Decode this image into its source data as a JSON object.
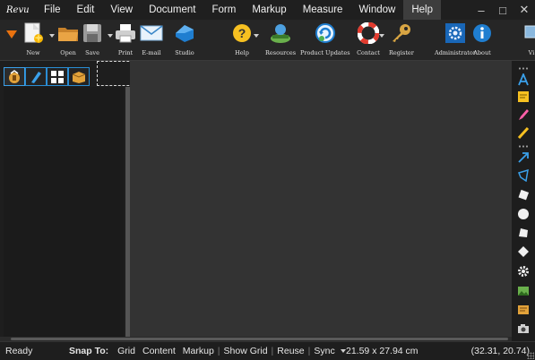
{
  "app": {
    "logo_text": "Revu"
  },
  "menu": {
    "items": [
      {
        "label": "File"
      },
      {
        "label": "Edit"
      },
      {
        "label": "View"
      },
      {
        "label": "Document"
      },
      {
        "label": "Form"
      },
      {
        "label": "Markup"
      },
      {
        "label": "Measure"
      },
      {
        "label": "Window"
      },
      {
        "label": "Help"
      }
    ]
  },
  "window_controls": {
    "minimize": "–",
    "maximize": "□",
    "close": "✕"
  },
  "toolbar": {
    "buttons": [
      {
        "label": "New",
        "icon": "new-document-icon"
      },
      {
        "label": "Open",
        "icon": "folder-icon"
      },
      {
        "label": "Save",
        "icon": "floppy-disk-icon"
      },
      {
        "label": "Print",
        "icon": "printer-icon"
      },
      {
        "label": "E-mail",
        "icon": "envelope-icon"
      },
      {
        "label": "Studio",
        "icon": "studio-icon"
      },
      {
        "label": "Help",
        "icon": "question-icon"
      },
      {
        "label": "Resources",
        "icon": "resources-icon"
      },
      {
        "label": "Product Updates",
        "icon": "update-icon"
      },
      {
        "label": "Contact",
        "icon": "lifebuoy-icon"
      },
      {
        "label": "Register",
        "icon": "key-icon"
      },
      {
        "label": "Administrator",
        "icon": "admin-gear-icon"
      },
      {
        "label": "About",
        "icon": "info-icon"
      },
      {
        "label": "Vi",
        "icon": "monitor-icon"
      }
    ]
  },
  "left_panel": {
    "tabs": [
      "bookmarks-tab-icon",
      "markup-tab-icon",
      "thumbnails-tab-icon",
      "properties-tab-icon"
    ]
  },
  "right_strip": {
    "tools": [
      "text-tool-icon",
      "note-tool-icon",
      "highlighter-tool-icon",
      "pen-tool-icon",
      "arrow-tool-icon",
      "polygon-tool-icon",
      "rectangle-tool-icon",
      "ellipse-tool-icon",
      "cloud-tool-icon",
      "stamp-tool-icon",
      "gear-tool-icon",
      "image-tool-icon",
      "sketch-tool-icon",
      "camera-tool-icon"
    ]
  },
  "statusbar": {
    "ready": "Ready",
    "snap_to": "Snap To:",
    "snap_options": [
      "Grid",
      "Content",
      "Markup",
      "Show Grid",
      "Reuse",
      "Sync"
    ],
    "page_size": "21.59 x 27.94 cm",
    "coordinates": "(32.31, 20.74)"
  },
  "colors": {
    "accent": "#2a8dd4",
    "canvas": "#333333",
    "chrome": "#1e1e1e"
  }
}
